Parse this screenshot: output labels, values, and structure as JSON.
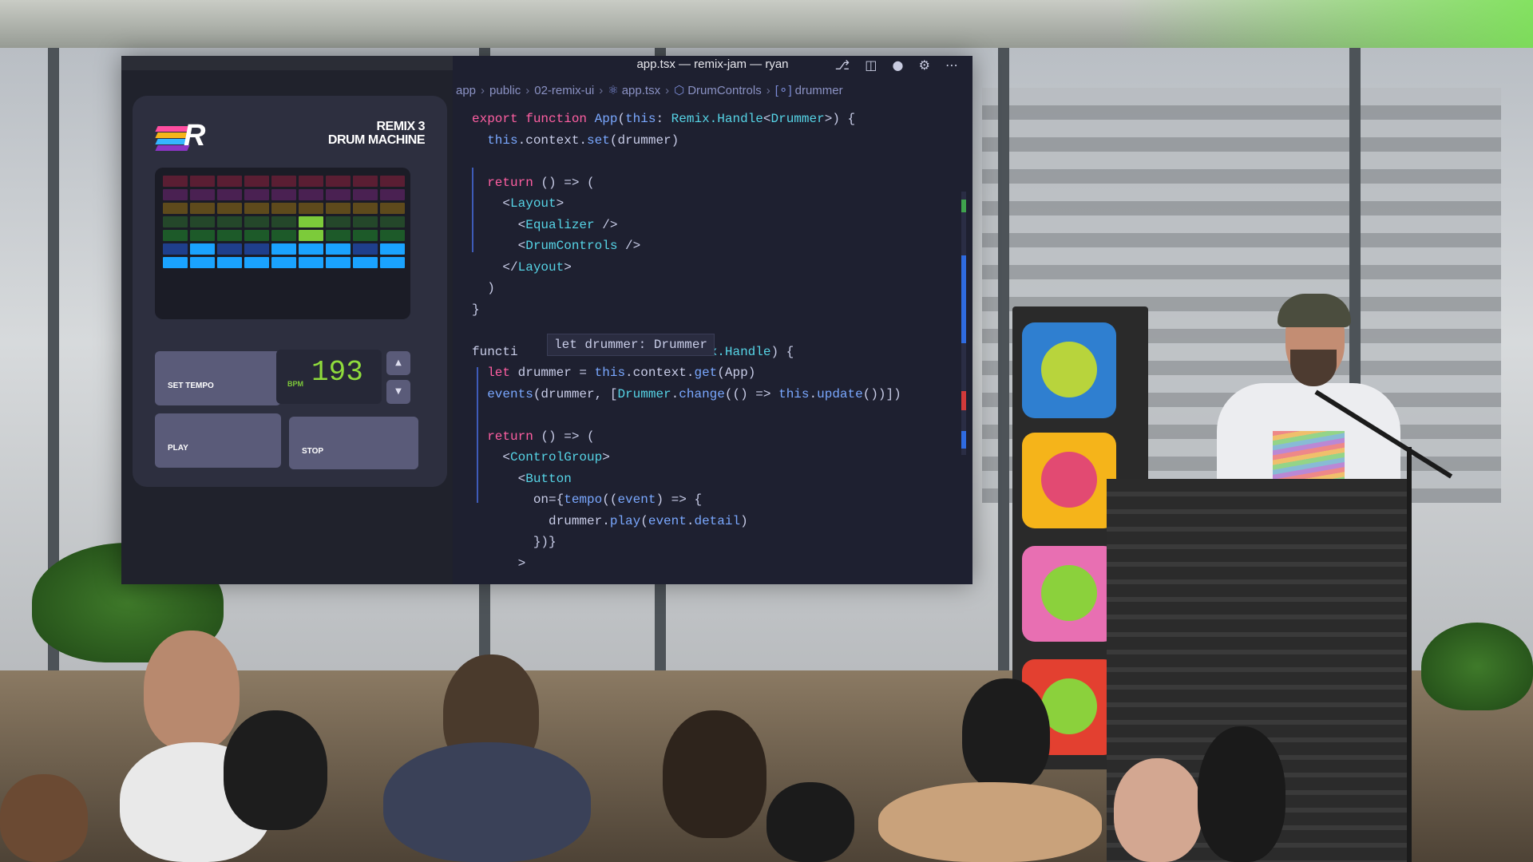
{
  "editor": {
    "window_title": "app.tsx — remix-jam — ryan",
    "title_icons": [
      "source-control-icon",
      "split-editor-icon",
      "unsaved-dot-icon",
      "gear-icon",
      "more-icon"
    ],
    "breadcrumb": [
      "app",
      "public",
      "02-remix-ui",
      "app.tsx",
      "DrumControls",
      "drummer"
    ],
    "hover_tooltip": "let drummer: Drummer",
    "code_lines": [
      "export function App(this: Remix.Handle<Drummer>) {",
      "  this.context.set(drummer)",
      "",
      "  return () => (",
      "    <Layout>",
      "      <Equalizer />",
      "      <DrumControls />",
      "    </Layout>",
      "  )",
      "}",
      "",
      "functi                     Remix.Handle) {",
      "  let drummer = this.context.get(App)",
      "  events(drummer, [Drummer.change(() => this.update())])",
      "",
      "  return () => (",
      "    <ControlGroup>",
      "      <Button",
      "        on={tempo((event) => {",
      "          drummer.play(event.detail)",
      "        })}",
      "      >"
    ]
  },
  "drum_app": {
    "title_line1": "REMIX 3",
    "title_line2": "DRUM MACHINE",
    "logo_letter": "R",
    "set_tempo_label": "SET TEMPO",
    "bpm_label": "BPM",
    "bpm_value": "193",
    "play_label": "PLAY",
    "stop_label": "STOP",
    "stepper_up": "▲",
    "stepper_down": "▼",
    "equalizer_columns_active_rows": [
      1,
      2,
      1,
      1,
      2,
      4,
      2,
      1,
      2
    ],
    "row_colors": [
      "#5a1e33",
      "#4a2152",
      "#5e4a1c",
      "#24472a",
      "#1d5a29",
      "#1f3f8c",
      "#1f3f8c"
    ],
    "active_row_colors": [
      "#d0203a",
      "#8a35c4",
      "#f5b41a",
      "#7ccb3a",
      "#7ccb3a",
      "#1aa3ff",
      "#1aa3ff"
    ]
  },
  "colors": {
    "keyword": "#ff5fa2",
    "function": "#7aa8ff",
    "type": "#56d4e6",
    "bpm_text": "#8fdc3c"
  }
}
